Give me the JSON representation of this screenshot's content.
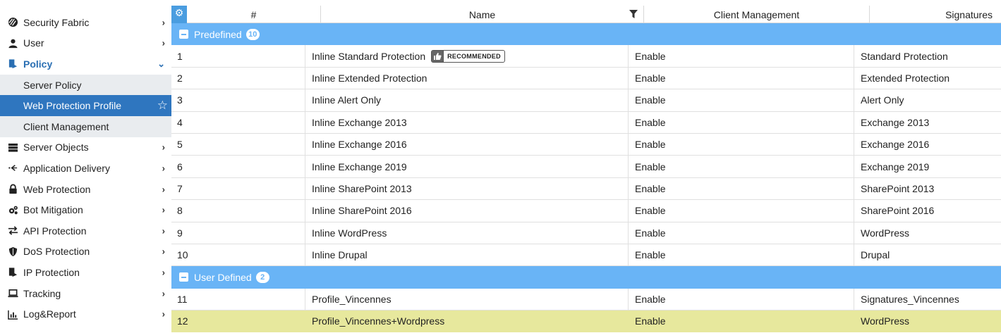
{
  "sidebar": {
    "items": [
      {
        "label": "Security Fabric",
        "icon": "security-fabric-icon"
      },
      {
        "label": "User",
        "icon": "user-icon"
      },
      {
        "label": "Policy",
        "icon": "policy-icon"
      },
      {
        "label": "Server Objects",
        "icon": "server-icon"
      },
      {
        "label": "Application Delivery",
        "icon": "application-delivery-icon"
      },
      {
        "label": "Web Protection",
        "icon": "lock-icon"
      },
      {
        "label": "Bot Mitigation",
        "icon": "gears-icon"
      },
      {
        "label": "API Protection",
        "icon": "exchange-arrows-icon"
      },
      {
        "label": "DoS Protection",
        "icon": "shield-icon"
      },
      {
        "label": "IP Protection",
        "icon": "policy-icon"
      },
      {
        "label": "Tracking",
        "icon": "laptop-icon"
      },
      {
        "label": "Log&Report",
        "icon": "bar-chart-icon"
      }
    ],
    "policy_sub": [
      {
        "label": "Server Policy"
      },
      {
        "label": "Web Protection Profile"
      },
      {
        "label": "Client Management"
      }
    ]
  },
  "table": {
    "headers": {
      "num": "#",
      "name": "Name",
      "client_management": "Client Management",
      "signatures": "Signatures"
    },
    "groups": [
      {
        "label": "Predefined",
        "count": "10",
        "rows": [
          {
            "num": "1",
            "name": "Inline Standard Protection",
            "badge": "RECOMMENDED",
            "cm": "Enable",
            "sig": "Standard Protection"
          },
          {
            "num": "2",
            "name": "Inline Extended Protection",
            "cm": "Enable",
            "sig": "Extended Protection"
          },
          {
            "num": "3",
            "name": "Inline Alert Only",
            "cm": "Enable",
            "sig": "Alert Only"
          },
          {
            "num": "4",
            "name": "Inline Exchange 2013",
            "cm": "Enable",
            "sig": "Exchange 2013"
          },
          {
            "num": "5",
            "name": "Inline Exchange 2016",
            "cm": "Enable",
            "sig": "Exchange 2016"
          },
          {
            "num": "6",
            "name": "Inline Exchange 2019",
            "cm": "Enable",
            "sig": "Exchange 2019"
          },
          {
            "num": "7",
            "name": "Inline SharePoint 2013",
            "cm": "Enable",
            "sig": "SharePoint 2013"
          },
          {
            "num": "8",
            "name": "Inline SharePoint 2016",
            "cm": "Enable",
            "sig": "SharePoint 2016"
          },
          {
            "num": "9",
            "name": "Inline WordPress",
            "cm": "Enable",
            "sig": "WordPress"
          },
          {
            "num": "10",
            "name": "Inline Drupal",
            "cm": "Enable",
            "sig": "Drupal"
          }
        ]
      },
      {
        "label": "User Defined",
        "count": "2",
        "rows": [
          {
            "num": "11",
            "name": "Profile_Vincennes",
            "cm": "Enable",
            "sig": "Signatures_Vincennes"
          },
          {
            "num": "12",
            "name": "Profile_Vincennes+Wordpress",
            "cm": "Enable",
            "sig": "WordPress"
          }
        ]
      }
    ]
  },
  "colors": {
    "group_bar": "#69b4f6",
    "active_nav": "#2f76bf",
    "selected_row": "#e7e89d"
  }
}
